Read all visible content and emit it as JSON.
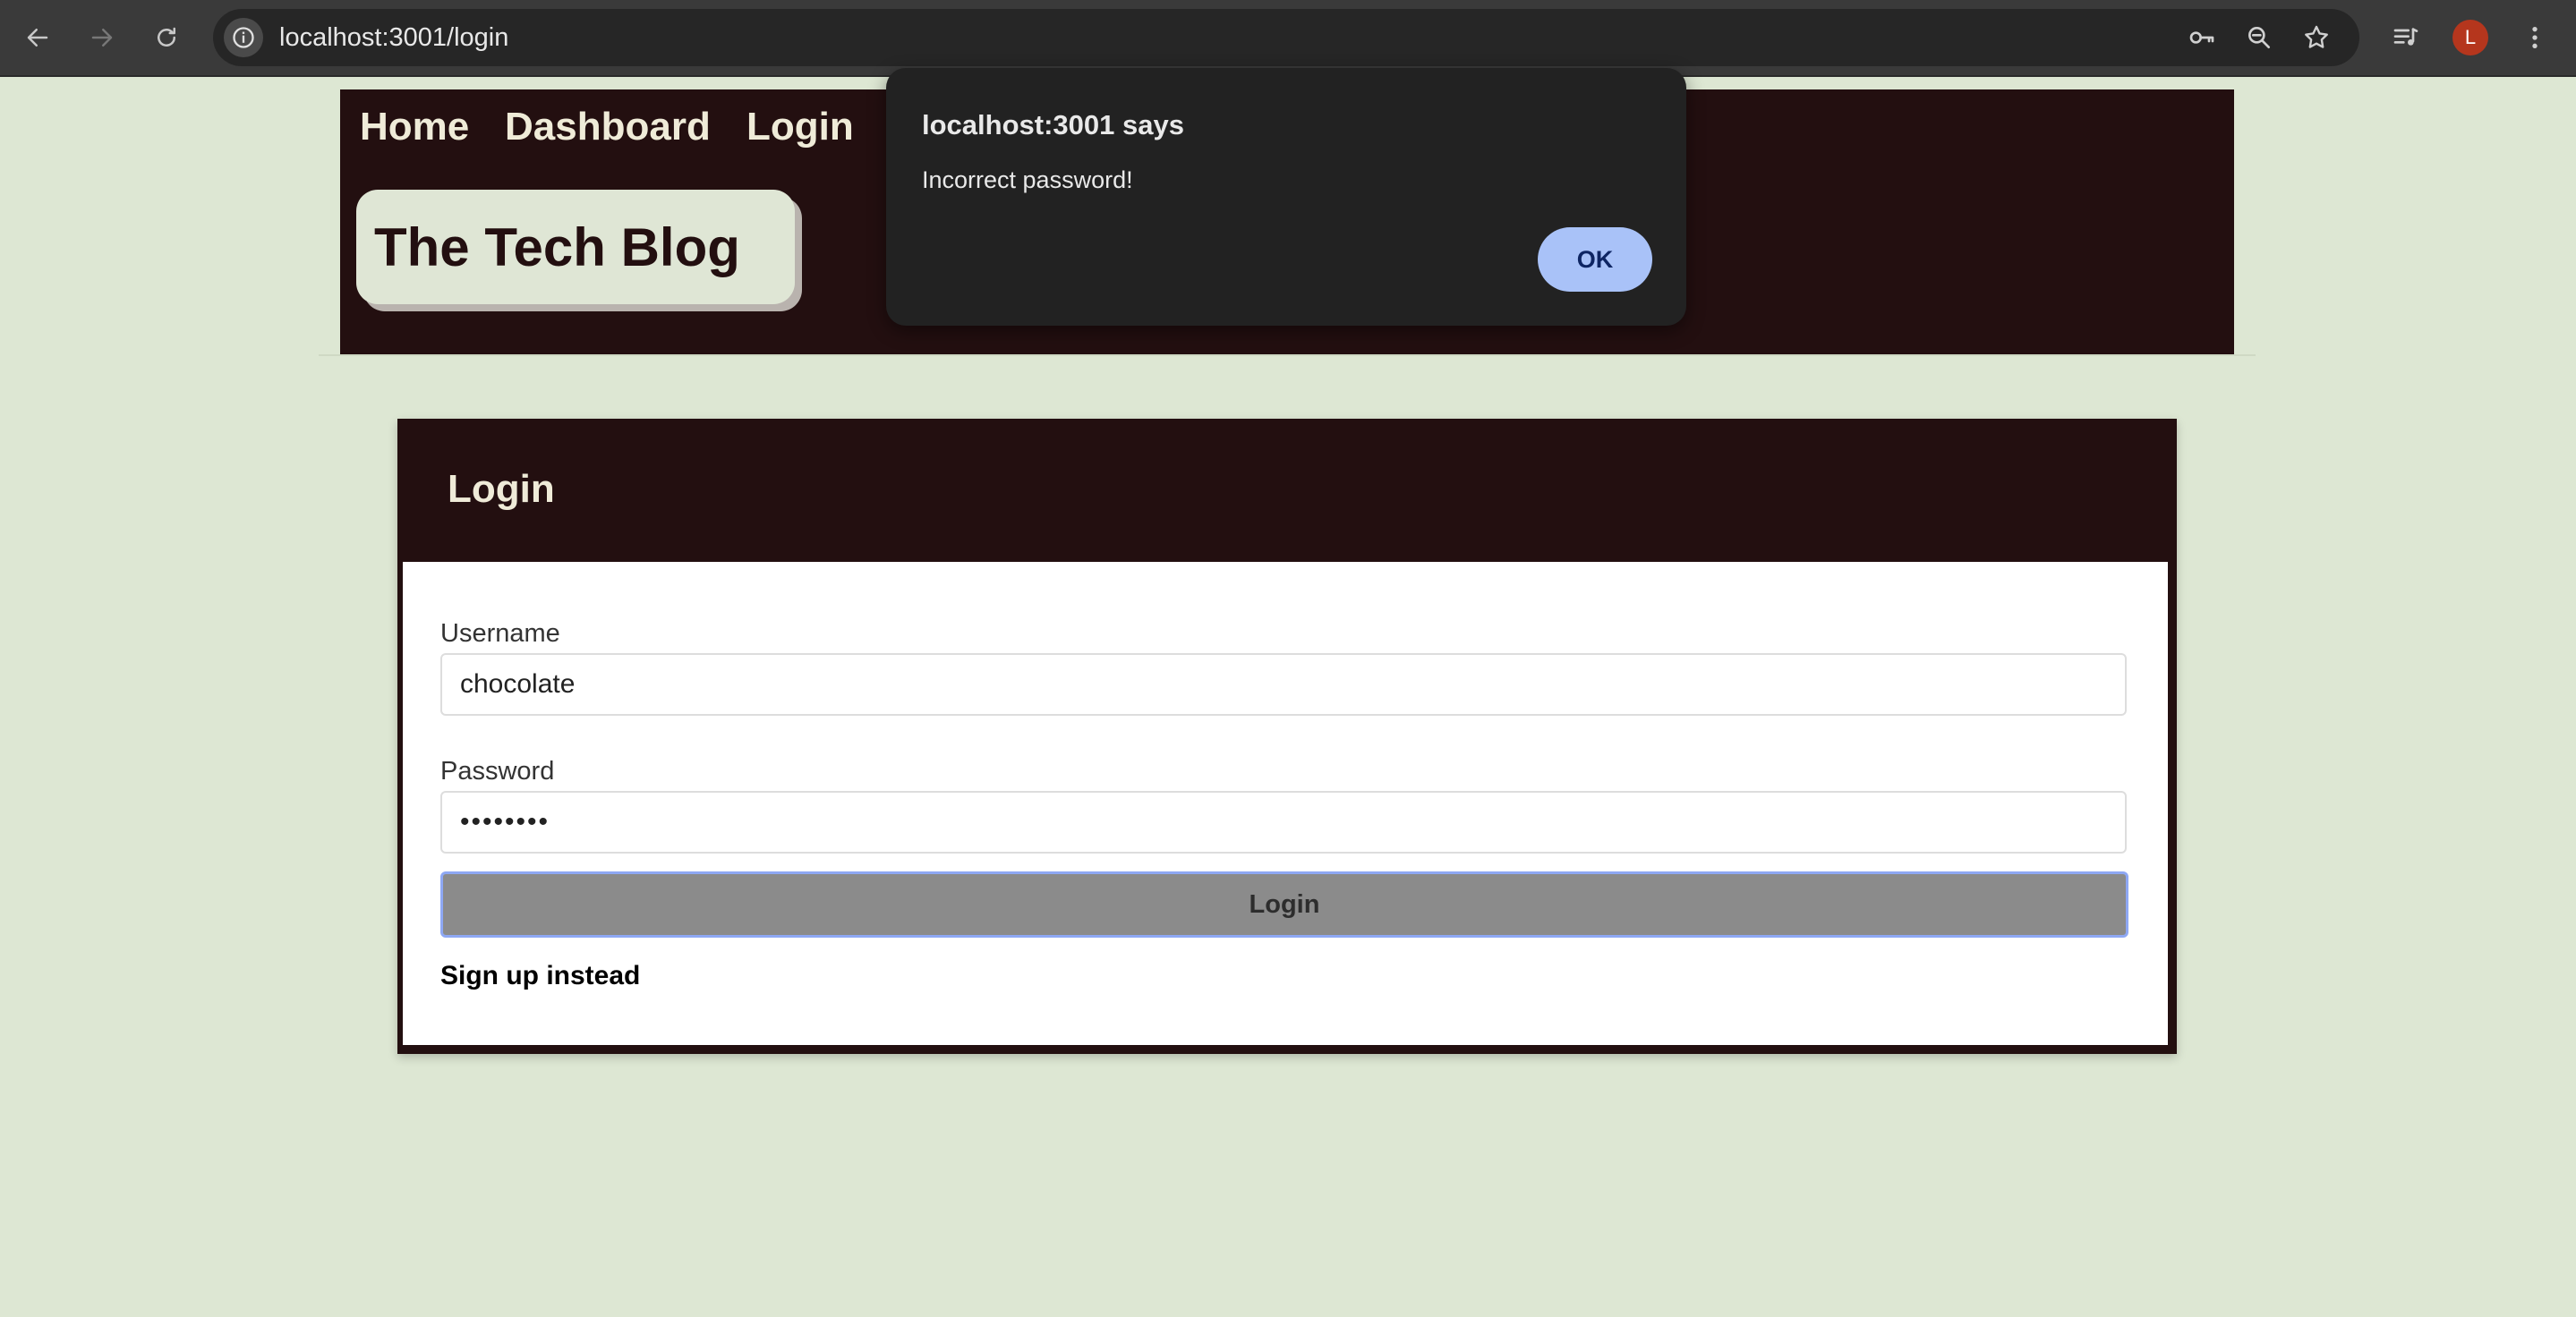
{
  "browser": {
    "url": "localhost:3001/login",
    "profile_initial": "L"
  },
  "header": {
    "nav": {
      "home": "Home",
      "dashboard": "Dashboard",
      "login": "Login"
    },
    "blog_title": "The Tech Blog"
  },
  "login_form": {
    "title": "Login",
    "username_label": "Username",
    "username_value": "chocolate",
    "password_label": "Password",
    "password_value": "••••••••",
    "submit_label": "Login",
    "signup_link": "Sign up instead"
  },
  "alert": {
    "title": "localhost:3001 says",
    "message": "Incorrect password!",
    "ok_label": "OK"
  },
  "colors": {
    "page_background": "#dde7d3",
    "header_background": "#230f10",
    "header_text": "#efebd8",
    "dialog_background": "#222222",
    "dialog_button": "#a9c2f8"
  }
}
